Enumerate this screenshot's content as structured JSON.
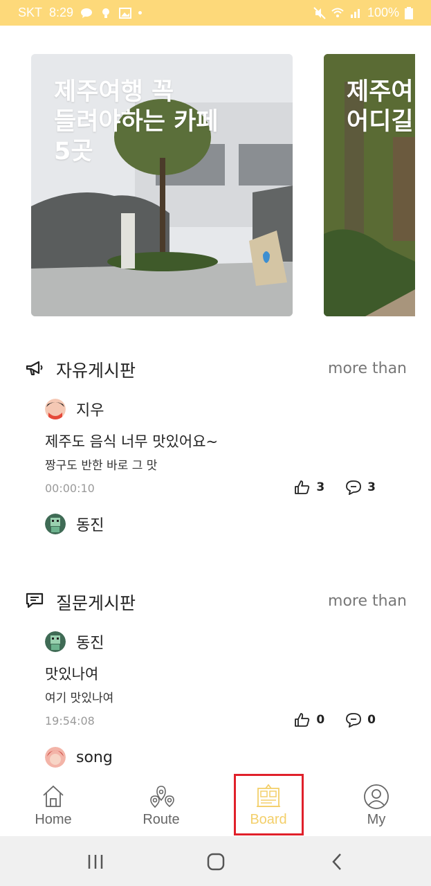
{
  "status_bar": {
    "carrier": "SKT",
    "time": "8:29",
    "battery": "100%"
  },
  "cards": [
    {
      "title": "제주여행 꼭\n들려야하는 카페\n5곳"
    },
    {
      "title": "제주여\n어디길"
    }
  ],
  "free_board": {
    "title": "자유게시판",
    "more": "more than",
    "post": {
      "author": "지우",
      "title": "제주도 음식 너무 맛있어요~",
      "body": "짱구도 반한 바로 그 맛",
      "time": "00:00:10",
      "likes": "3",
      "comments": "3"
    },
    "next_author": "동진"
  },
  "qna_board": {
    "title": "질문게시판",
    "more": "more than",
    "post": {
      "author": "동진",
      "title": "맛있나여",
      "body": "여기 맛있나여",
      "time": "19:54:08",
      "likes": "0",
      "comments": "0"
    },
    "next_author": "song"
  },
  "bottom_nav": {
    "items": [
      {
        "label": "Home",
        "icon": "home-icon"
      },
      {
        "label": "Route",
        "icon": "route-icon"
      },
      {
        "label": "Board",
        "icon": "board-icon"
      },
      {
        "label": "My",
        "icon": "user-icon"
      }
    ],
    "active": "Board",
    "active_color": "#f3cf6a"
  },
  "colors": {
    "status_bar": "#fdd97a",
    "highlight_box": "#e0202a"
  }
}
